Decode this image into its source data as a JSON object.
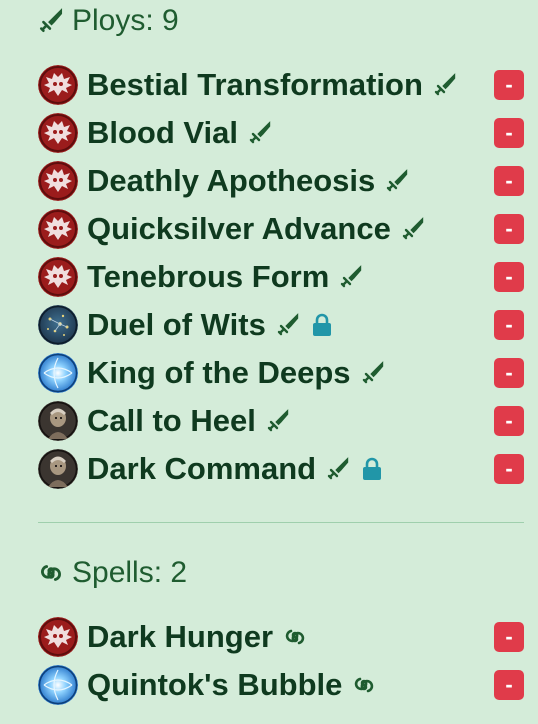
{
  "ploys": {
    "header": "Ploys: 9",
    "items": [
      {
        "name": "Bestial Transformation",
        "avatar": "vampire-bat-icon",
        "locked": false
      },
      {
        "name": "Blood Vial",
        "avatar": "vampire-bat-icon",
        "locked": false
      },
      {
        "name": "Deathly Apotheosis",
        "avatar": "vampire-bat-icon",
        "locked": false
      },
      {
        "name": "Quicksilver Advance",
        "avatar": "vampire-bat-icon",
        "locked": false
      },
      {
        "name": "Tenebrous Form",
        "avatar": "vampire-bat-icon",
        "locked": false
      },
      {
        "name": "Duel of Wits",
        "avatar": "starry-icon",
        "locked": true
      },
      {
        "name": "King of the Deeps",
        "avatar": "blue-swirl-icon",
        "locked": false
      },
      {
        "name": "Call to Heel",
        "avatar": "warrior-portrait-icon",
        "locked": false
      },
      {
        "name": "Dark Command",
        "avatar": "warrior-portrait-icon",
        "locked": true
      }
    ]
  },
  "spells": {
    "header": "Spells: 2",
    "items": [
      {
        "name": "Dark Hunger",
        "avatar": "vampire-bat-icon"
      },
      {
        "name": "Quintok's Bubble",
        "avatar": "blue-swirl-icon"
      }
    ]
  },
  "remove_label": "-",
  "colors": {
    "background": "#d4ecd9",
    "text": "#0f3a1f",
    "header": "#1f5c30",
    "remove": "#e03b4a",
    "lock": "#2196a8",
    "bat_avatar": "#9b1c1c"
  }
}
